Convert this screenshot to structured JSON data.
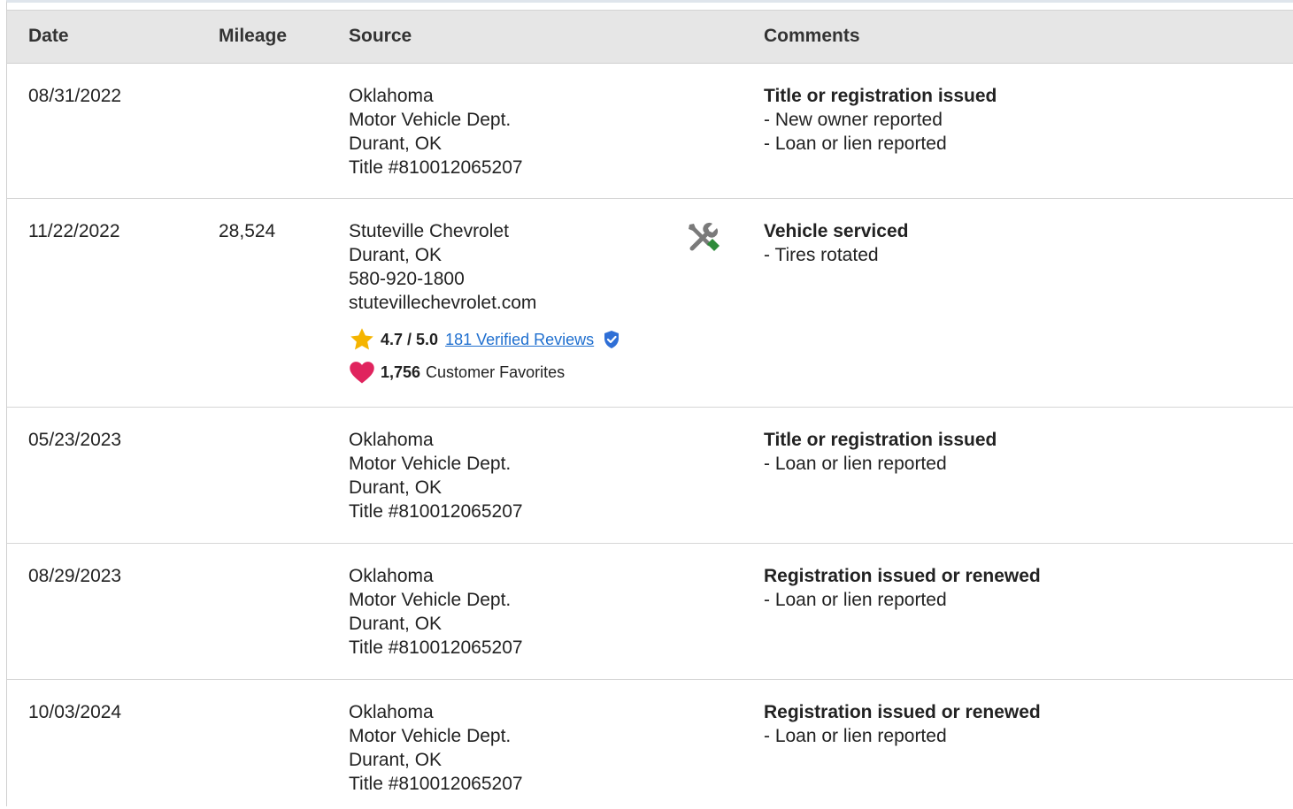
{
  "columns": {
    "date": "Date",
    "mileage": "Mileage",
    "source": "Source",
    "comments": "Comments"
  },
  "rows": [
    {
      "date": "08/31/2022",
      "mileage": "",
      "source": [
        "Oklahoma",
        "Motor Vehicle Dept.",
        "Durant, OK",
        "Title #810012065207"
      ],
      "comment_title": "Title or registration issued",
      "comment_items": [
        "- New owner reported",
        "- Loan or lien reported"
      ]
    },
    {
      "date": "11/22/2022",
      "mileage": "28,524",
      "source": [
        "Stuteville Chevrolet",
        "Durant, OK",
        "580-920-1800",
        "stutevillechevrolet.com"
      ],
      "rating": "4.7 / 5.0",
      "reviews_link": "181 Verified Reviews",
      "favorites_count": "1,756",
      "favorites_label": "Customer Favorites",
      "service_icon": "tools-icon",
      "comment_title": "Vehicle serviced",
      "comment_items": [
        "- Tires rotated"
      ]
    },
    {
      "date": "05/23/2023",
      "mileage": "",
      "source": [
        "Oklahoma",
        "Motor Vehicle Dept.",
        "Durant, OK",
        "Title #810012065207"
      ],
      "comment_title": "Title or registration issued",
      "comment_items": [
        "- Loan or lien reported"
      ]
    },
    {
      "date": "08/29/2023",
      "mileage": "",
      "source": [
        "Oklahoma",
        "Motor Vehicle Dept.",
        "Durant, OK",
        "Title #810012065207"
      ],
      "comment_title": "Registration issued or renewed",
      "comment_items": [
        "- Loan or lien reported"
      ]
    },
    {
      "date": "10/03/2024",
      "mileage": "",
      "source": [
        "Oklahoma",
        "Motor Vehicle Dept.",
        "Durant, OK",
        "Title #810012065207"
      ],
      "comment_title": "Registration issued or renewed",
      "comment_items": [
        "- Loan or lien reported"
      ]
    }
  ],
  "colors": {
    "header_bg": "#e6e6e6",
    "link": "#1f6fcf",
    "star": "#f5b400",
    "heart": "#e0245e",
    "verified": "#2f6fd6",
    "tool_gray": "#7a7a7a",
    "tool_green": "#2e8b3a"
  }
}
